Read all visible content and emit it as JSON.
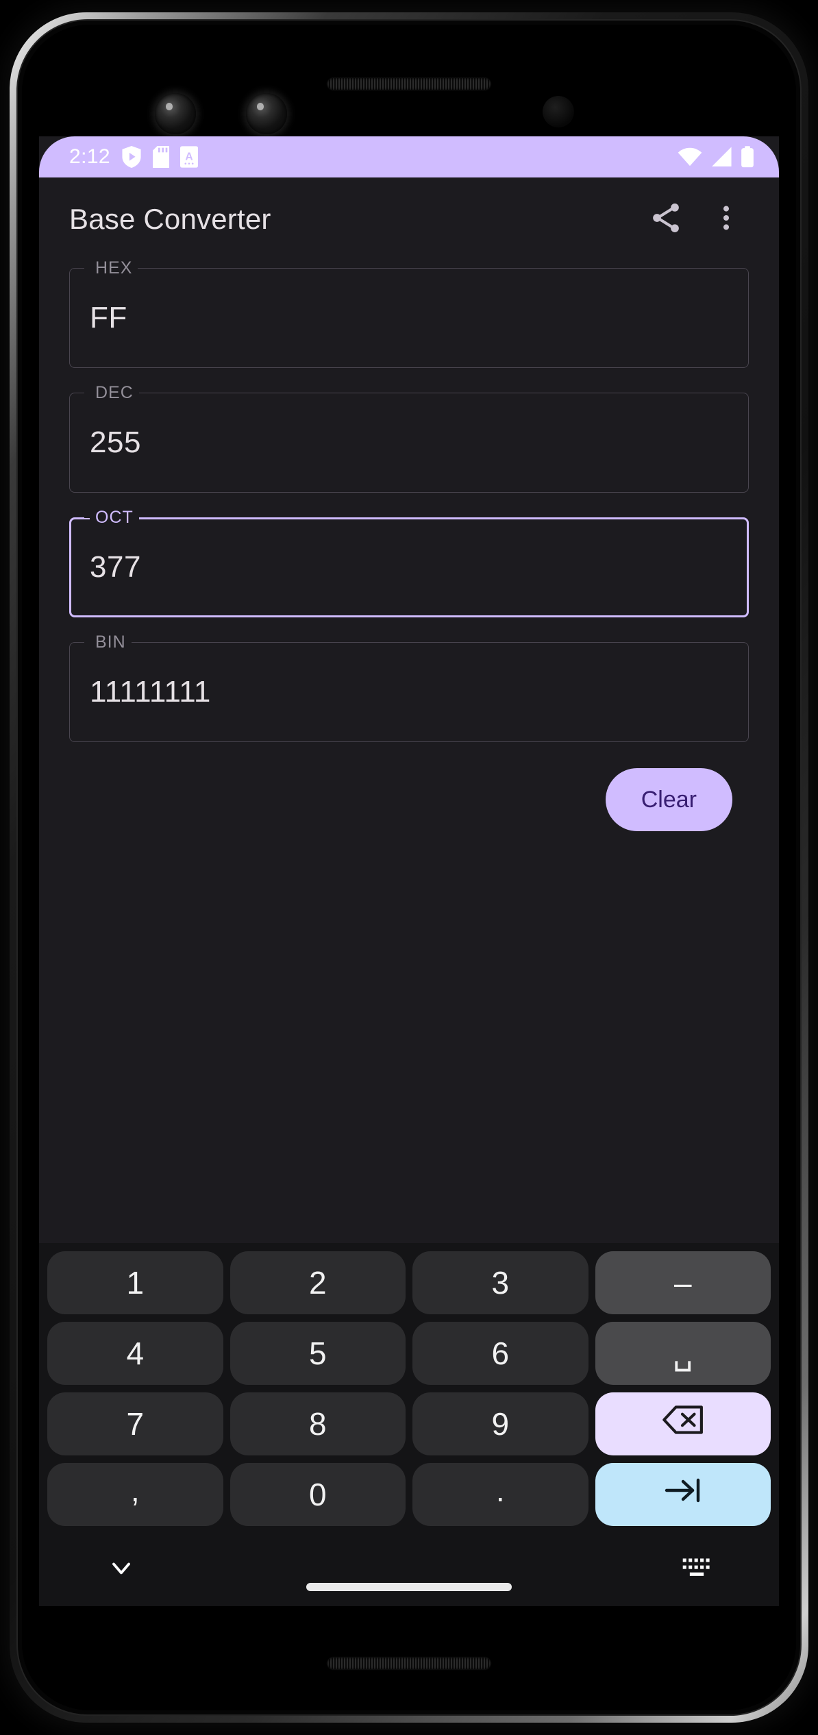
{
  "status_bar": {
    "time": "2:12",
    "left_icons": [
      "play-protect-shield-icon",
      "sd-card-icon",
      "screenshot-a-icon"
    ],
    "right_icons": [
      "wifi-icon",
      "cellular-signal-icon",
      "battery-full-icon"
    ],
    "background_color": "#D0BCFF",
    "icon_color": "#FFFFFF"
  },
  "app_bar": {
    "title": "Base Converter",
    "actions": [
      {
        "name": "share-icon",
        "label": "Share"
      },
      {
        "name": "overflow-menu-icon",
        "label": "More options"
      }
    ],
    "title_color": "#E6E1E5",
    "background_color": "#1C1B1F"
  },
  "fields": [
    {
      "label": "HEX",
      "value": "FF",
      "focused": false
    },
    {
      "label": "DEC",
      "value": "255",
      "focused": false
    },
    {
      "label": "OCT",
      "value": "377",
      "focused": true
    },
    {
      "label": "BIN",
      "value": "11111111",
      "focused": false
    }
  ],
  "clear_button": {
    "label": "Clear",
    "background_color": "#D0BCFF",
    "text_color": "#381E72"
  },
  "keyboard": {
    "rows": [
      [
        {
          "label": "1",
          "name": "key-1",
          "type": "digit"
        },
        {
          "label": "2",
          "name": "key-2",
          "type": "digit"
        },
        {
          "label": "3",
          "name": "key-3",
          "type": "digit"
        },
        {
          "label": "–",
          "name": "key-minus",
          "type": "fn"
        }
      ],
      [
        {
          "label": "4",
          "name": "key-4",
          "type": "digit"
        },
        {
          "label": "5",
          "name": "key-5",
          "type": "digit"
        },
        {
          "label": "6",
          "name": "key-6",
          "type": "digit"
        },
        {
          "label": "␣",
          "name": "key-space",
          "type": "fn"
        }
      ],
      [
        {
          "label": "7",
          "name": "key-7",
          "type": "digit"
        },
        {
          "label": "8",
          "name": "key-8",
          "type": "digit"
        },
        {
          "label": "9",
          "name": "key-9",
          "type": "digit"
        },
        {
          "label": "",
          "name": "key-backspace",
          "type": "backspace"
        }
      ],
      [
        {
          "label": ",",
          "name": "key-comma",
          "type": "digit"
        },
        {
          "label": "0",
          "name": "key-0",
          "type": "digit"
        },
        {
          "label": ".",
          "name": "key-period",
          "type": "digit"
        },
        {
          "label": "",
          "name": "key-tab-next",
          "type": "tab"
        }
      ]
    ],
    "key_color": "#2C2C2E",
    "fn_key_color": "#4A4A4C",
    "backspace_color": "#E9DDFF",
    "tab_key_color": "#BFE6FA"
  },
  "nav_bar": {
    "hide_keyboard_icon": "chevron-down-icon",
    "switch_keyboard_icon": "keyboard-switch-icon",
    "home_indicator": "home-indicator"
  }
}
